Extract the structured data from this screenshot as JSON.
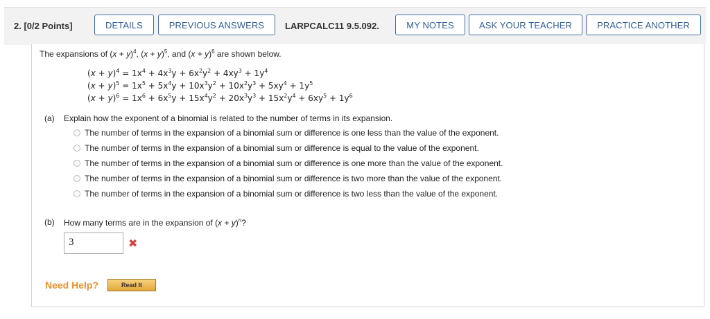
{
  "header": {
    "question_number": "2.",
    "points": "[0/2 Points]",
    "buttons": {
      "details": "DETAILS",
      "previous_answers": "PREVIOUS ANSWERS",
      "my_notes": "MY NOTES",
      "ask_teacher": "ASK YOUR TEACHER",
      "practice_another": "PRACTICE ANOTHER"
    },
    "problem_code": "LARPCALC11 9.5.092."
  },
  "intro": {
    "text_before": "The expansions of ",
    "text_after": " are shown below.",
    "exponents": [
      "4",
      "5",
      "6"
    ]
  },
  "equations": [
    {
      "exp": "4",
      "rhs": [
        "1x",
        "4",
        " + 4x",
        "3",
        "y + 6x",
        "2",
        "y",
        "2",
        " + 4xy",
        "3",
        " + 1y",
        "4"
      ]
    },
    {
      "exp": "5",
      "rhs": [
        "1x",
        "5",
        " + 5x",
        "4",
        "y + 10x",
        "3",
        "y",
        "2",
        " + 10x",
        "2",
        "y",
        "3",
        " + 5xy",
        "4",
        " + 1y",
        "5"
      ]
    },
    {
      "exp": "6",
      "rhs": [
        "1x",
        "6",
        " + 6x",
        "5",
        "y + 15x",
        "4",
        "y",
        "2",
        " + 20x",
        "3",
        "y",
        "3",
        " + 15x",
        "2",
        "y",
        "4",
        " + 6xy",
        "5",
        " + 1y",
        "6"
      ]
    }
  ],
  "part_a": {
    "label": "(a)",
    "question": "Explain how the exponent of a binomial is related to the number of terms in its expansion.",
    "options": [
      "The number of terms in the expansion of a binomial sum or difference is one less than the value of the exponent.",
      "The number of terms in the expansion of a binomial sum or difference is equal to the value of the exponent.",
      "The number of terms in the expansion of a binomial sum or difference is one more than the value of the exponent.",
      "The number of terms in the expansion of a binomial sum or difference is two more than the value of the exponent.",
      "The number of terms in the expansion of a binomial sum or difference is two less than the value of the exponent."
    ]
  },
  "part_b": {
    "label": "(b)",
    "question_before": "How many terms are in the expansion of ",
    "exponent": "n",
    "question_after": "?",
    "answer_value": "3",
    "result_mark": "✖"
  },
  "help": {
    "label": "Need Help?",
    "read_it": "Read It"
  },
  "colors": {
    "button_border": "#3f6ea6",
    "button_text": "#2f5f98",
    "wrong_mark": "#d9423a",
    "need_help": "#e3922b"
  }
}
